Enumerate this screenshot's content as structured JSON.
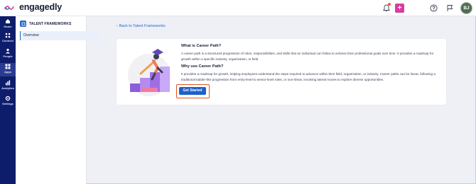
{
  "app": {
    "brand": "engagedly"
  },
  "header": {
    "icons": [
      "bell-icon",
      "plus-icon",
      "help-icon",
      "flag-icon"
    ],
    "avatar_initials": "BJ",
    "colors": {
      "plus": "#d63e9a",
      "notification_dot": "#f15b42",
      "avatar": "#4f6f52"
    }
  },
  "rail": {
    "items": [
      {
        "label": "Home",
        "icon": "home-icon"
      },
      {
        "label": "Connect",
        "icon": "connect-icon"
      },
      {
        "label": "People",
        "icon": "people-icon"
      },
      {
        "label": "Apps",
        "icon": "apps-icon",
        "active": true
      },
      {
        "label": "Analytics",
        "icon": "analytics-icon"
      },
      {
        "label": "Settings",
        "icon": "settings-icon"
      }
    ],
    "color": "#0e1d6b"
  },
  "sidebar": {
    "title": "TALENT FRAMEWORKS",
    "items": [
      {
        "label": "Overview",
        "selected": true
      }
    ]
  },
  "main": {
    "back_link": "Back to Talent Frameworks",
    "what_title": "What is Career Path?",
    "what_text": "A career path is a structured progression of roles, responsibilities, and skills that an individual can follow to achieve their professional goals over time. It provides a roadmap for growth within a specific industry, organization, or field",
    "why_title": "Why use Career Path?",
    "why_text": "It provides a roadmap for growth, helping employees understand the steps required to advance within their field, organization, or industry. Career paths can be linear, following a traditional ladder-like progression from entry-level to senior-level roles, or non-linear, involving lateral moves to explore diverse opportunities.",
    "cta": "Get Started",
    "colors": {
      "accent": "#2767c6",
      "button": "#1f5fc8",
      "highlight": "#e0531f"
    }
  }
}
